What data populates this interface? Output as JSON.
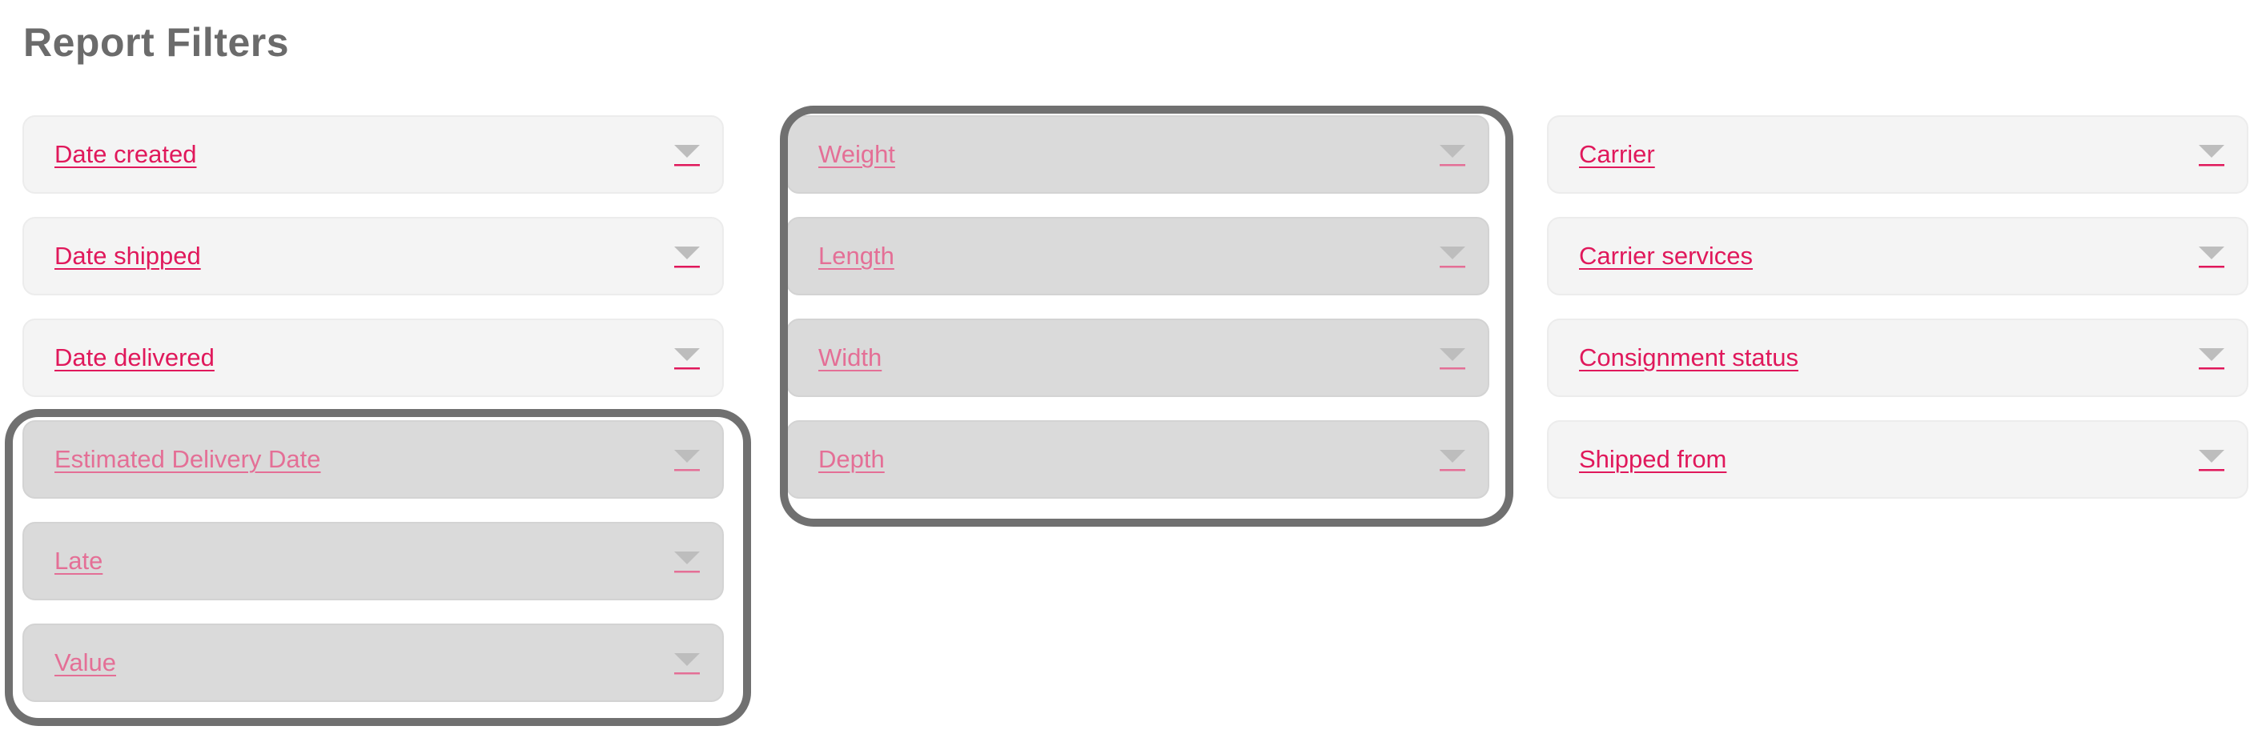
{
  "page": {
    "title": "Report Filters"
  },
  "colors": {
    "accent": "#e0185b",
    "accent_disabled": "#e46f96",
    "filter_bg": "#f4f4f4",
    "filter_bg_disabled": "#dadada",
    "caret": "#bdbdbd",
    "caret_underline": "#e0185b",
    "highlight_outline": "#707070",
    "title": "#6b6b6b"
  },
  "icons": {
    "dropdown": "caret-down-icon"
  },
  "filters": {
    "column1": [
      {
        "label": "Date created",
        "disabled": false
      },
      {
        "label": "Date shipped",
        "disabled": false
      },
      {
        "label": "Date delivered",
        "disabled": false
      },
      {
        "label": "Estimated Delivery Date",
        "disabled": true
      },
      {
        "label": "Late",
        "disabled": true
      },
      {
        "label": "Value",
        "disabled": true
      }
    ],
    "column2": [
      {
        "label": "Weight",
        "disabled": true
      },
      {
        "label": "Length",
        "disabled": true
      },
      {
        "label": "Width",
        "disabled": true
      },
      {
        "label": "Depth",
        "disabled": true
      }
    ],
    "column3": [
      {
        "label": "Carrier",
        "disabled": false
      },
      {
        "label": "Carrier services",
        "disabled": false
      },
      {
        "label": "Consignment status",
        "disabled": false
      },
      {
        "label": "Shipped from",
        "disabled": false
      }
    ]
  }
}
